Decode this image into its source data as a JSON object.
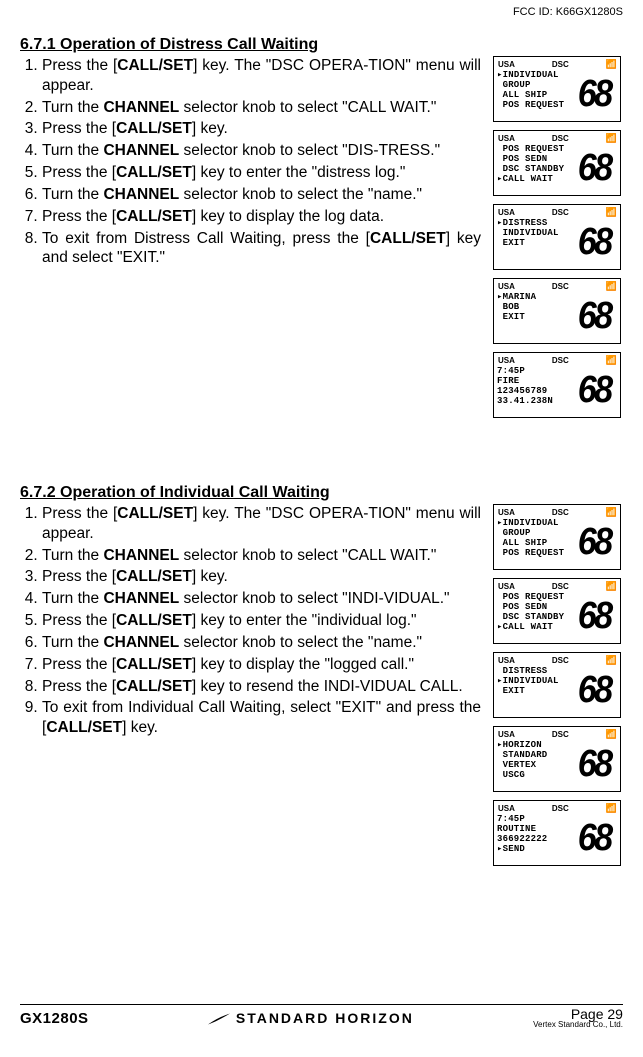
{
  "fcc": "FCC ID: K66GX1280S",
  "section1": {
    "heading": "6.7.1 Operation of Distress Call Waiting",
    "steps": [
      {
        "pre": "Press the  [",
        "key": "CALL/SET",
        "post": "] key. The \"DSC OPERA-TION\" menu will appear."
      },
      {
        "pre": "Turn the ",
        "key": "CHANNEL",
        "post": " selector knob to select \"CALL WAIT.\""
      },
      {
        "pre": "Press the [",
        "key": "CALL/SET",
        "post": "] key."
      },
      {
        "pre": "Turn the ",
        "key": "CHANNEL",
        "post": " selector knob to select \"DIS-TRESS.\""
      },
      {
        "pre": "Press the [",
        "key": "CALL/SET",
        "post": "] key to enter the \"distress log.\""
      },
      {
        "pre": "Turn the ",
        "key": "CHANNEL",
        "post": " selector knob to select the \"name.\""
      },
      {
        "pre": "Press the [",
        "key": "CALL/SET",
        "post": "] key to display the log data."
      },
      {
        "pre": "To exit from Distress Call Waiting, press the [",
        "key": "CALL/SET",
        "post": "] key and select \"EXIT.\""
      }
    ]
  },
  "section2": {
    "heading": "6.7.2  Operation of Individual Call Waiting",
    "steps": [
      {
        "pre": "Press the  [",
        "key": "CALL/SET",
        "post": "] key. The \"DSC OPERA-TION\" menu will appear."
      },
      {
        "pre": "Turn the ",
        "key": "CHANNEL",
        "post": " selector knob to select \"CALL WAIT.\""
      },
      {
        "pre": "Press the [",
        "key": "CALL/SET",
        "post": "] key."
      },
      {
        "pre": "Turn the ",
        "key": "CHANNEL",
        "post": " selector knob to select \"INDI-VIDUAL.\""
      },
      {
        "pre": "Press the [",
        "key": "CALL/SET",
        "post": "] key to enter the \"individual log.\""
      },
      {
        "pre": "Turn the ",
        "key": "CHANNEL",
        "post": " selector knob to select the \"name.\""
      },
      {
        "pre": "Press the [",
        "key": "CALL/SET",
        "post": "] key to display the \"logged call.\""
      },
      {
        "pre": "Press the [",
        "key": "CALL/SET",
        "post": "] key to resend the INDI-VIDUAL CALL."
      },
      {
        "pre": "To exit from Individual Call Waiting, select \"EXIT\" and press the [",
        "key": "CALL/SET",
        "post": "] key."
      }
    ]
  },
  "lcd_common": {
    "usa": "USA",
    "dsc": "DSC",
    "big": "68"
  },
  "lcds1": [
    "▸INDIVIDUAL\n GROUP\n ALL SHIP\n POS REQUEST",
    " POS REQUEST\n POS SEDN\n DSC STANDBY\n▸CALL WAIT",
    "▸DISTRESS\n INDIVIDUAL\n EXIT",
    "▸MARINA\n BOB\n EXIT",
    "7:45P\nFIRE\n123456789\n33.41.238N"
  ],
  "lcds2": [
    "▸INDIVIDUAL\n GROUP\n ALL SHIP\n POS REQUEST",
    " POS REQUEST\n POS SEDN\n DSC STANDBY\n▸CALL WAIT",
    " DISTRESS\n▸INDIVIDUAL\n EXIT",
    "▸HORIZON\n STANDARD\n VERTEX\n USCG",
    "7:45P\nROUTINE\n366922222\n▸SEND"
  ],
  "footer": {
    "left": "GX1280S",
    "brand": "STANDARD HORIZON",
    "page": "Page 29",
    "vertex": "Vertex Standard Co., Ltd."
  }
}
